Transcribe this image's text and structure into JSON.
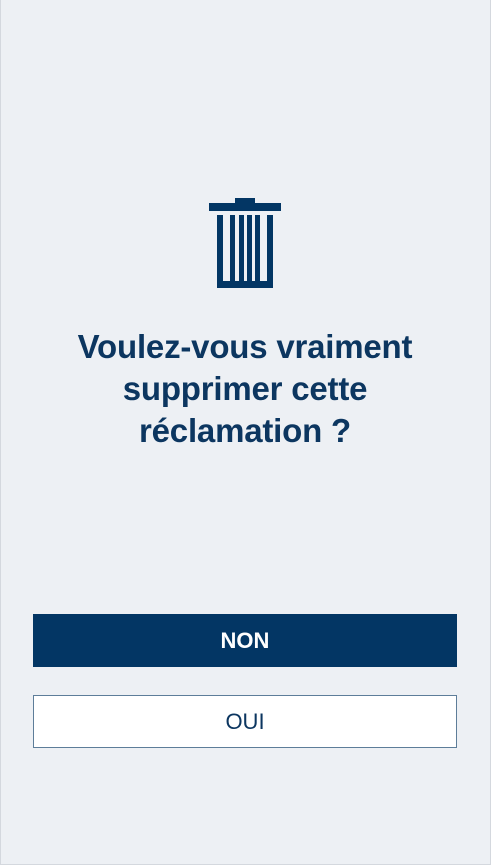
{
  "dialog": {
    "icon": "trash-icon",
    "message": "Voulez-vous vraiment supprimer cette réclamation ?",
    "buttons": {
      "no_label": "NON",
      "yes_label": "OUI"
    }
  },
  "colors": {
    "background": "#edf0f4",
    "primary": "#033664",
    "text": "#0c3660",
    "button_secondary_bg": "#ffffff"
  }
}
